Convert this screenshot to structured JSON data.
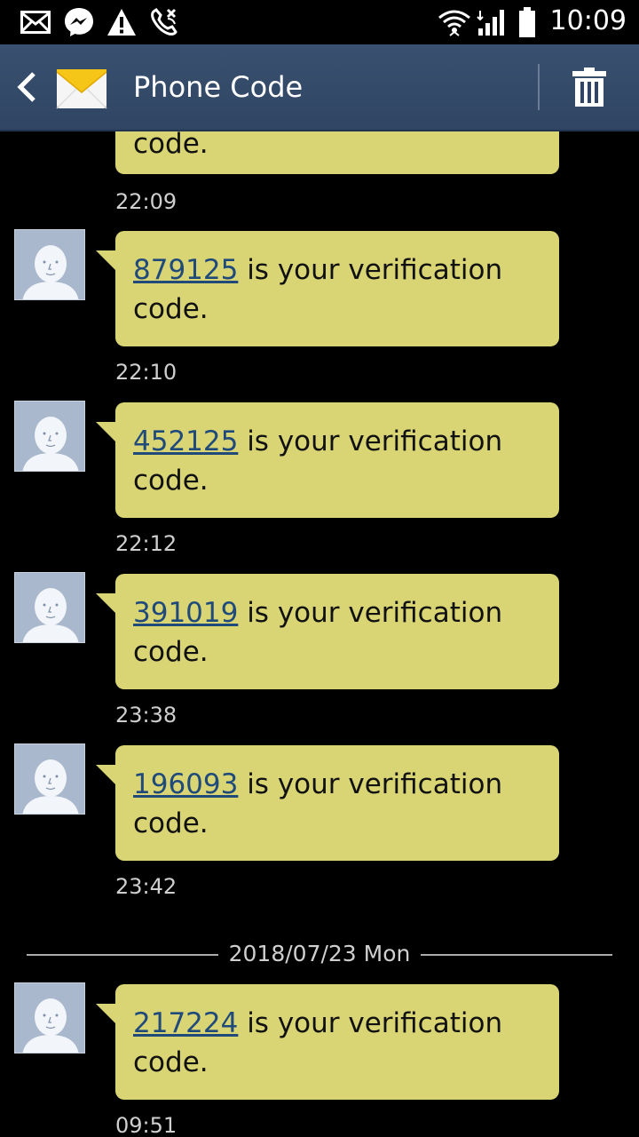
{
  "status_bar": {
    "time": "10:09",
    "icons": [
      "mail-icon",
      "messenger-icon",
      "warning-icon",
      "missed-call-icon",
      "wifi-icon",
      "signal-icon",
      "battery-icon"
    ]
  },
  "action_bar": {
    "title": "Phone Code",
    "back": "back-icon",
    "delete": "trash-icon"
  },
  "messages": [
    {
      "code": "",
      "text": "code.",
      "time": "22:09"
    },
    {
      "code": "879125",
      "text": " is your verification code.",
      "time": "22:10"
    },
    {
      "code": "452125",
      "text": " is your verification code.",
      "time": "22:12"
    },
    {
      "code": "391019",
      "text": " is your verification code.",
      "time": "23:38"
    },
    {
      "code": "196093",
      "text": " is your verification code.",
      "time": "23:42"
    },
    {
      "code": "217224",
      "text": " is your verification code.",
      "time": "09:51"
    }
  ],
  "date_separator": "2018/07/23 Mon",
  "colors": {
    "bubble": "#d9d575",
    "action_bar": "#34496a",
    "link": "#204a7a"
  }
}
